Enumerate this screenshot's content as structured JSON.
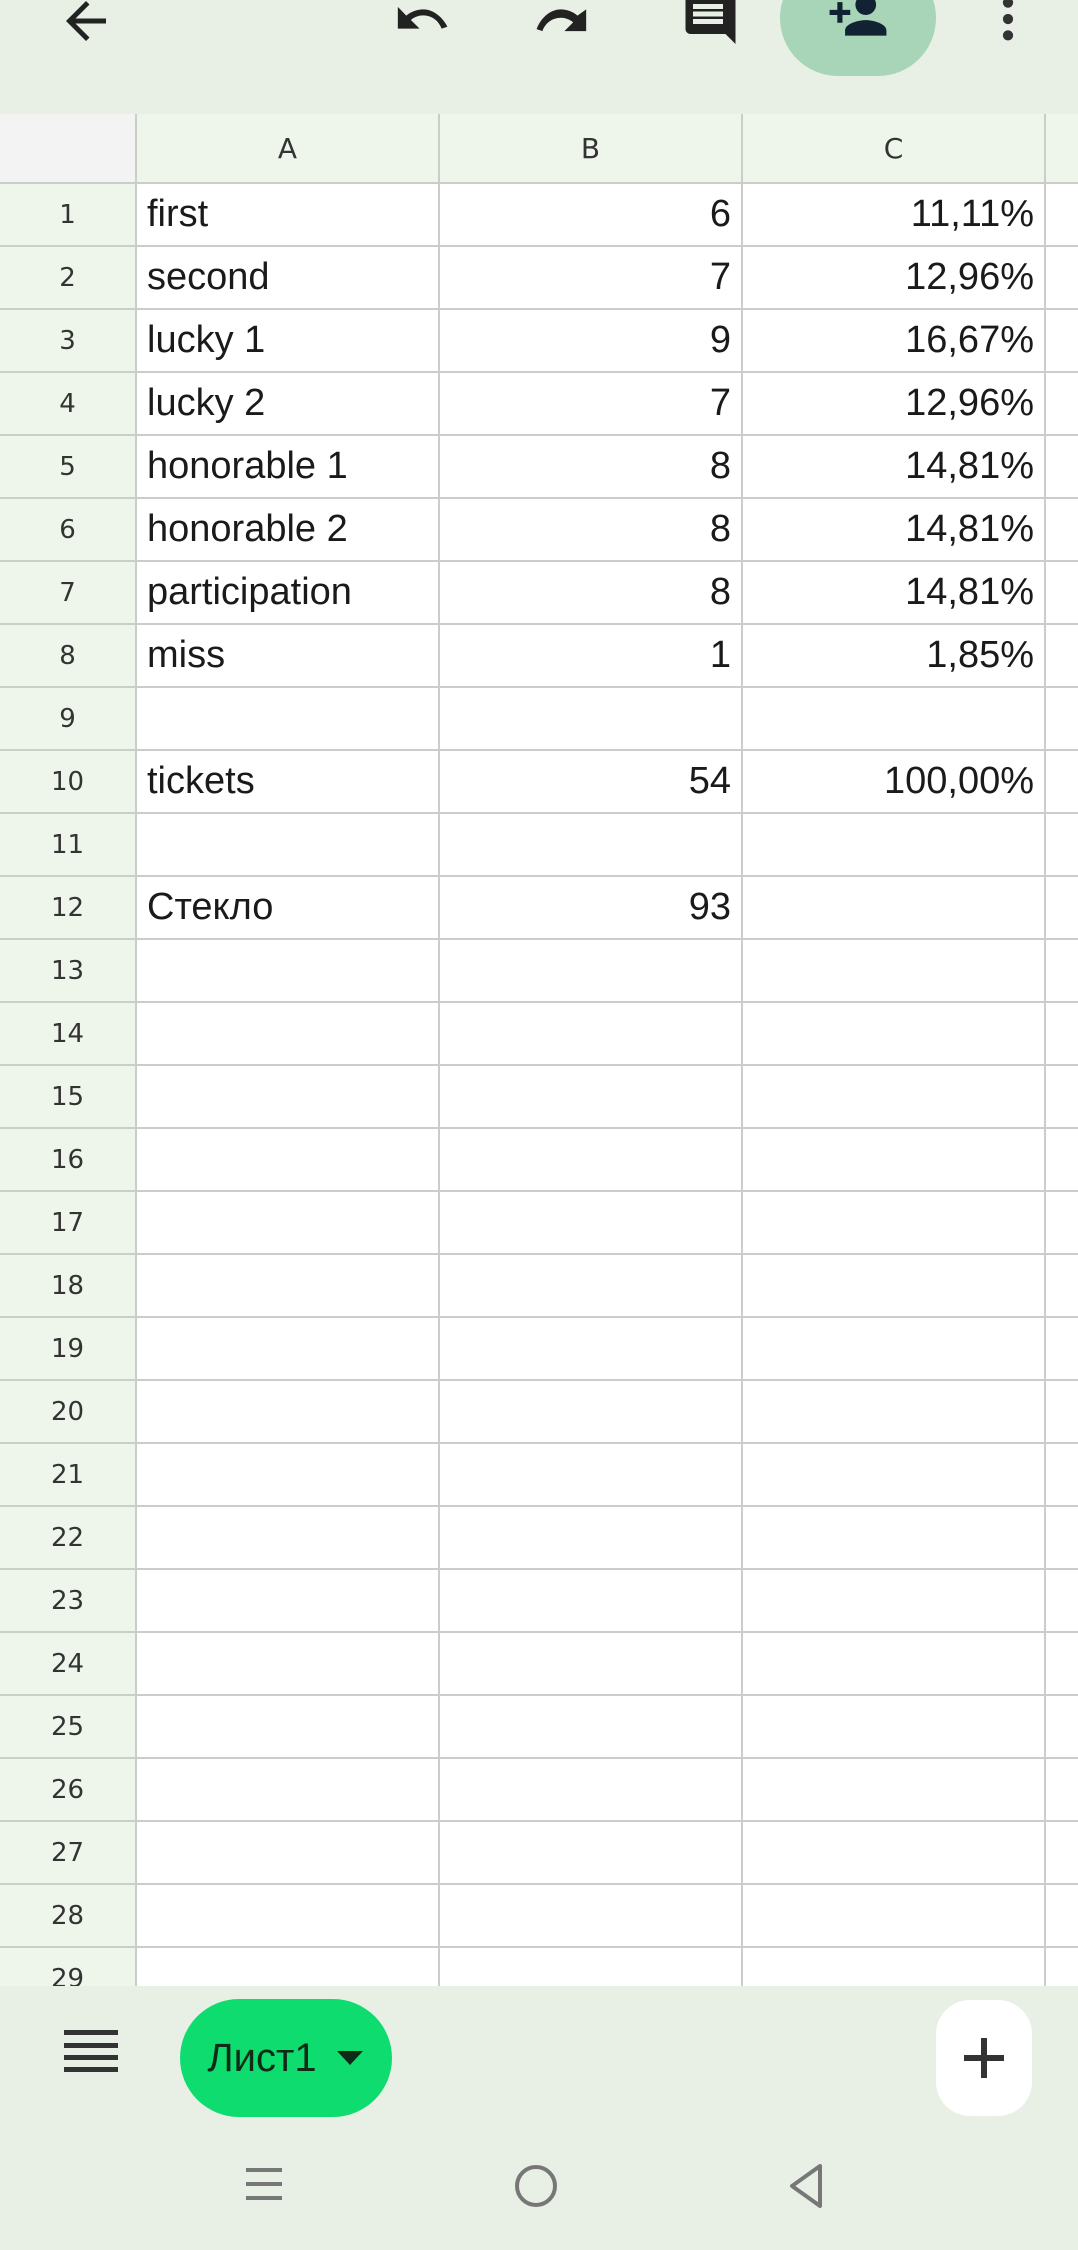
{
  "toolbar": {
    "icons": [
      "back-arrow-icon",
      "undo-icon",
      "redo-icon",
      "comment-icon",
      "add-person-icon",
      "more-vert-icon"
    ]
  },
  "grid": {
    "columns": [
      "A",
      "B",
      "C"
    ],
    "rows": [
      {
        "num": "1",
        "a": "first",
        "b": "6",
        "c": "11,11%"
      },
      {
        "num": "2",
        "a": "second",
        "b": "7",
        "c": "12,96%"
      },
      {
        "num": "3",
        "a": "lucky 1",
        "b": "9",
        "c": "16,67%"
      },
      {
        "num": "4",
        "a": "lucky 2",
        "b": "7",
        "c": "12,96%"
      },
      {
        "num": "5",
        "a": "honorable 1",
        "b": "8",
        "c": "14,81%"
      },
      {
        "num": "6",
        "a": "honorable 2",
        "b": "8",
        "c": "14,81%"
      },
      {
        "num": "7",
        "a": "participation",
        "b": "8",
        "c": "14,81%"
      },
      {
        "num": "8",
        "a": "miss",
        "b": "1",
        "c": "1,85%"
      },
      {
        "num": "9",
        "a": "",
        "b": "",
        "c": ""
      },
      {
        "num": "10",
        "a": "tickets",
        "b": "54",
        "c": "100,00%"
      },
      {
        "num": "11",
        "a": "",
        "b": "",
        "c": ""
      },
      {
        "num": "12",
        "a": "Стекло",
        "b": "93",
        "c": ""
      },
      {
        "num": "13",
        "a": "",
        "b": "",
        "c": ""
      },
      {
        "num": "14",
        "a": "",
        "b": "",
        "c": ""
      },
      {
        "num": "15",
        "a": "",
        "b": "",
        "c": ""
      },
      {
        "num": "16",
        "a": "",
        "b": "",
        "c": ""
      },
      {
        "num": "17",
        "a": "",
        "b": "",
        "c": ""
      },
      {
        "num": "18",
        "a": "",
        "b": "",
        "c": ""
      },
      {
        "num": "19",
        "a": "",
        "b": "",
        "c": ""
      },
      {
        "num": "20",
        "a": "",
        "b": "",
        "c": ""
      },
      {
        "num": "21",
        "a": "",
        "b": "",
        "c": ""
      },
      {
        "num": "22",
        "a": "",
        "b": "",
        "c": ""
      },
      {
        "num": "23",
        "a": "",
        "b": "",
        "c": ""
      },
      {
        "num": "24",
        "a": "",
        "b": "",
        "c": ""
      },
      {
        "num": "25",
        "a": "",
        "b": "",
        "c": ""
      },
      {
        "num": "26",
        "a": "",
        "b": "",
        "c": ""
      },
      {
        "num": "27",
        "a": "",
        "b": "",
        "c": ""
      },
      {
        "num": "28",
        "a": "",
        "b": "",
        "c": ""
      },
      {
        "num": "29",
        "a": "",
        "b": "",
        "c": ""
      }
    ]
  },
  "sheetbar": {
    "active_sheet": "Лист1",
    "icons": [
      "sheet-list-icon",
      "dropdown-caret-icon",
      "plus-icon"
    ]
  },
  "navbar": {
    "icons": [
      "recents-icon",
      "home-icon",
      "back-triangle-icon"
    ]
  },
  "colors": {
    "toolbar_bg": "#e8f0e6",
    "header_bg": "#eef6ec",
    "accent": "#0fdc6e",
    "share_bg": "#a8d5b8"
  }
}
